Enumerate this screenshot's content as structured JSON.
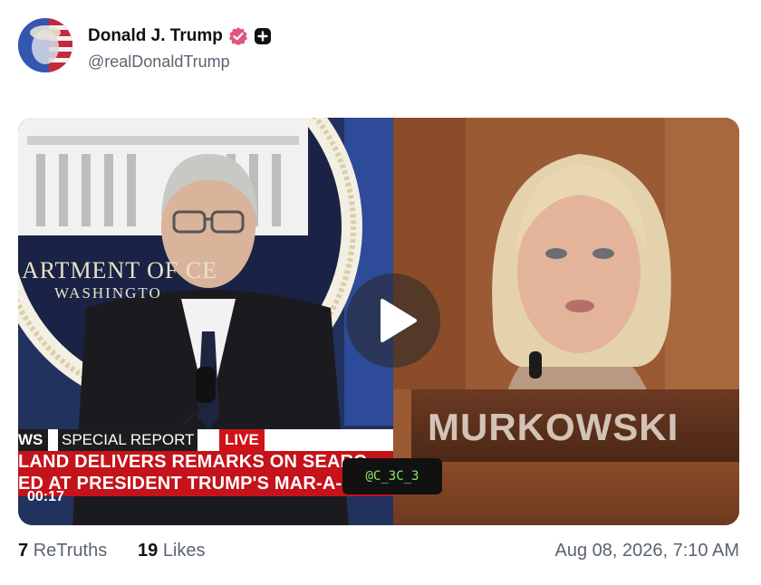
{
  "post": {
    "author_name": "Donald J. Trump",
    "handle": "@realDonaldTrump",
    "retruths_count": "7",
    "retruths_label": "ReTruths",
    "likes_count": "19",
    "likes_label": "Likes",
    "timestamp": "Aug 08, 2026, 7:10 AM"
  },
  "video": {
    "duration": "00:17",
    "watermark": "@C_3C_3",
    "left_frame": {
      "seal_text_top": "ARTMENT OF   CE",
      "seal_text_bottom": "WASHINGTO",
      "chyron_network": "WS",
      "chyron_label": "SPECIAL REPORT",
      "chyron_live": "LIVE",
      "headline_line1": "LAND DELIVERS REMARKS ON SEARC",
      "headline_line2": "ED AT PRESIDENT TRUMP'S MAR-A-L"
    },
    "right_frame": {
      "nameplate": "MURKOWSKI"
    }
  },
  "colors": {
    "verified_badge": "#e0567a",
    "chyron_red": "#c4131b",
    "watermark_text": "#8fe36d"
  },
  "icons": [
    "verified-badge-icon",
    "plus-badge-icon",
    "play-icon"
  ]
}
